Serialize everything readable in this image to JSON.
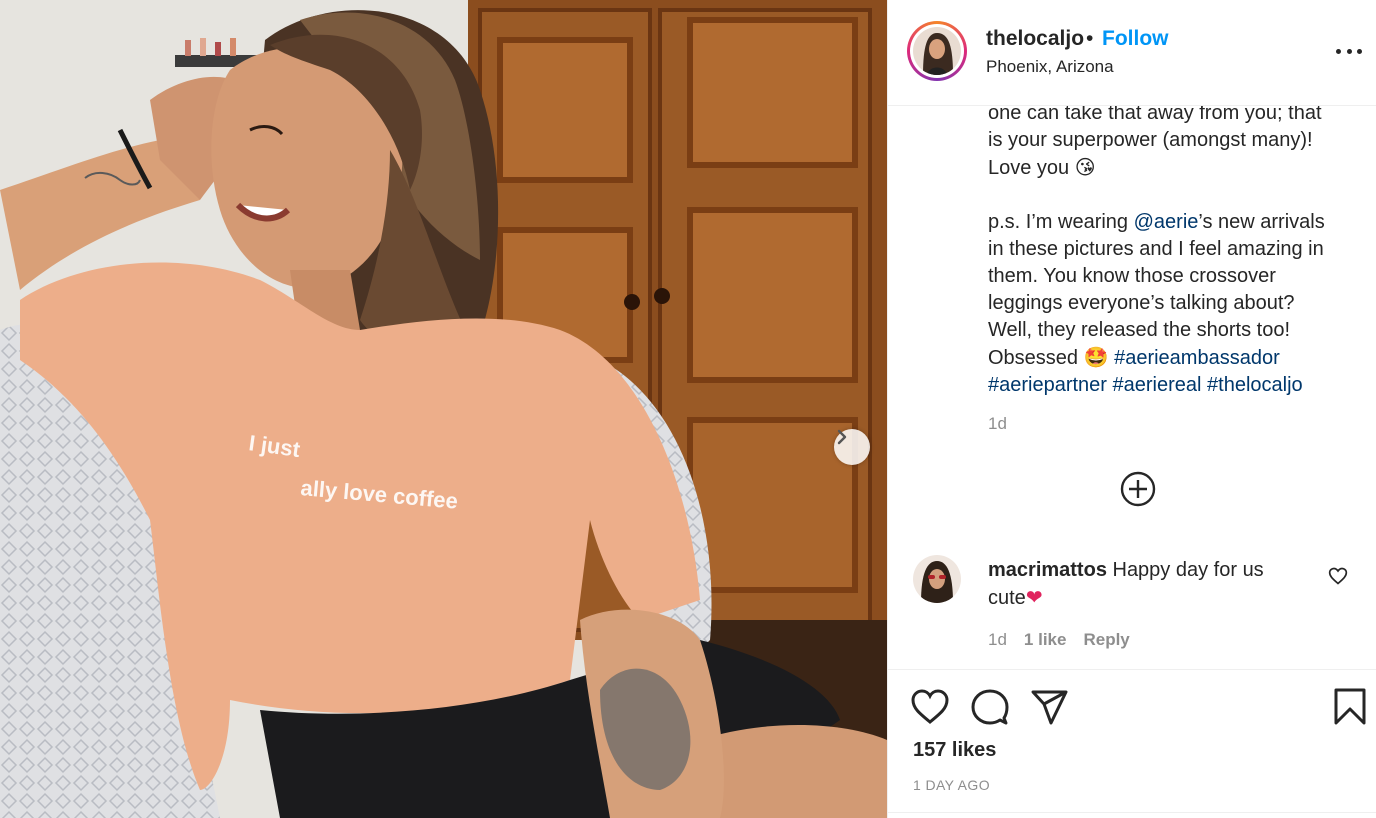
{
  "post": {
    "username": "thelocaljo",
    "separator": "•",
    "follow_label": "Follow",
    "location": "Phoenix, Arizona",
    "shirt_text_line1": "I just",
    "shirt_text_line2": "ally love coffee"
  },
  "caption": {
    "lines": [
      "one can take that away from you; that",
      "is your superpower (amongst many)!"
    ],
    "love_text": "Love you ",
    "love_emoji": "😘",
    "ps_prefix": "p.s. I’m wearing ",
    "mention": "@aerie",
    "ps_suffix": "’s new arrivals",
    "lines2": [
      "in these pictures and I feel amazing in",
      "them. You know those crossover",
      "leggings everyone’s talking about?",
      "Well, they released the shorts too!"
    ],
    "obsessed_text": "Obsessed ",
    "obsessed_emoji": "🤩",
    "hashtag1": "#aerieambassador",
    "hashtag2": "#aeriepartner",
    "hashtag3": "#aeriereal",
    "hashtag4": "#thelocaljo",
    "time": "1d"
  },
  "comment": {
    "username": "macrimattos",
    "text_line1": " Happy day for us",
    "text_line2": "cute",
    "emoji": "❤",
    "time": "1d",
    "likes": "1 like",
    "reply_label": "Reply"
  },
  "footer": {
    "likes": "157 likes",
    "age": "1 DAY AGO"
  },
  "icons": {
    "like": "heart-icon",
    "comment": "comment-bubble-icon",
    "share": "paper-plane-icon",
    "save": "bookmark-icon",
    "more": "more-options-icon",
    "load_more": "plus-circle-icon",
    "next": "chevron-right-icon"
  },
  "colors": {
    "follow": "#0095f6",
    "link": "#00376b",
    "muted": "#8e8e8e",
    "emoji_heart": "#e0245e"
  }
}
